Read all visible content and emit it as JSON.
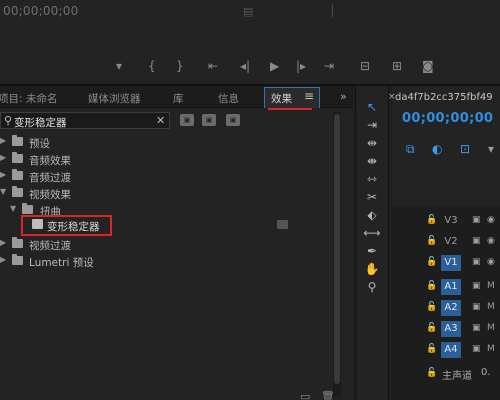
{
  "monitor": {
    "timecode": "00;00;00;00",
    "mid_icon": "lift-icon",
    "transport_icons": [
      "marker-icon",
      "in-point-icon",
      "out-point-icon",
      "go-to-in-icon",
      "step-back-icon",
      "play-icon",
      "step-forward-icon",
      "go-to-out-icon",
      "insert-icon",
      "overwrite-icon",
      "export-frame-icon"
    ]
  },
  "project_panel": {
    "tabs": [
      {
        "label": "项目: 未命名"
      },
      {
        "label": "媒体浏览器"
      },
      {
        "label": "库"
      },
      {
        "label": "信息"
      },
      {
        "label": "效果",
        "active": true
      },
      {
        "label": "≡"
      }
    ],
    "more_label": "»",
    "search": {
      "icon": "search-icon",
      "value": "变形稳定器",
      "clear": "✕"
    },
    "tree": [
      {
        "label": "预设",
        "depth": 0,
        "expanded": false
      },
      {
        "label": "音频效果",
        "depth": 0,
        "expanded": false
      },
      {
        "label": "音频过渡",
        "depth": 0,
        "expanded": false
      },
      {
        "label": "视频效果",
        "depth": 0,
        "expanded": true
      },
      {
        "label": "扭曲",
        "depth": 1,
        "expanded": true
      },
      {
        "label": "变形稳定器",
        "depth": 2,
        "selected": true
      },
      {
        "label": "视频过渡",
        "depth": 0,
        "expanded": false
      },
      {
        "label": "Lumetri 预设",
        "depth": 0,
        "expanded": false
      }
    ]
  },
  "timeline": {
    "sequence_name": "da4f7b2cc375fbf49",
    "close_label": "×",
    "timecode": "00;00;00;00",
    "tracks": [
      {
        "name": "V3",
        "targeted": false
      },
      {
        "name": "V2",
        "targeted": false
      },
      {
        "name": "V1",
        "targeted": true
      },
      {
        "name": "A1",
        "targeted": true,
        "audio": true
      },
      {
        "name": "A2",
        "targeted": true,
        "audio": true
      },
      {
        "name": "A3",
        "targeted": true,
        "audio": true
      },
      {
        "name": "A4",
        "targeted": true,
        "audio": true
      }
    ],
    "mute_label": "M",
    "master_label": "主声道",
    "master_value": "0."
  },
  "colors": {
    "accent": "#2e8fe0",
    "highlight_red": "#d6262b",
    "track_on": "#2a5f9a"
  }
}
